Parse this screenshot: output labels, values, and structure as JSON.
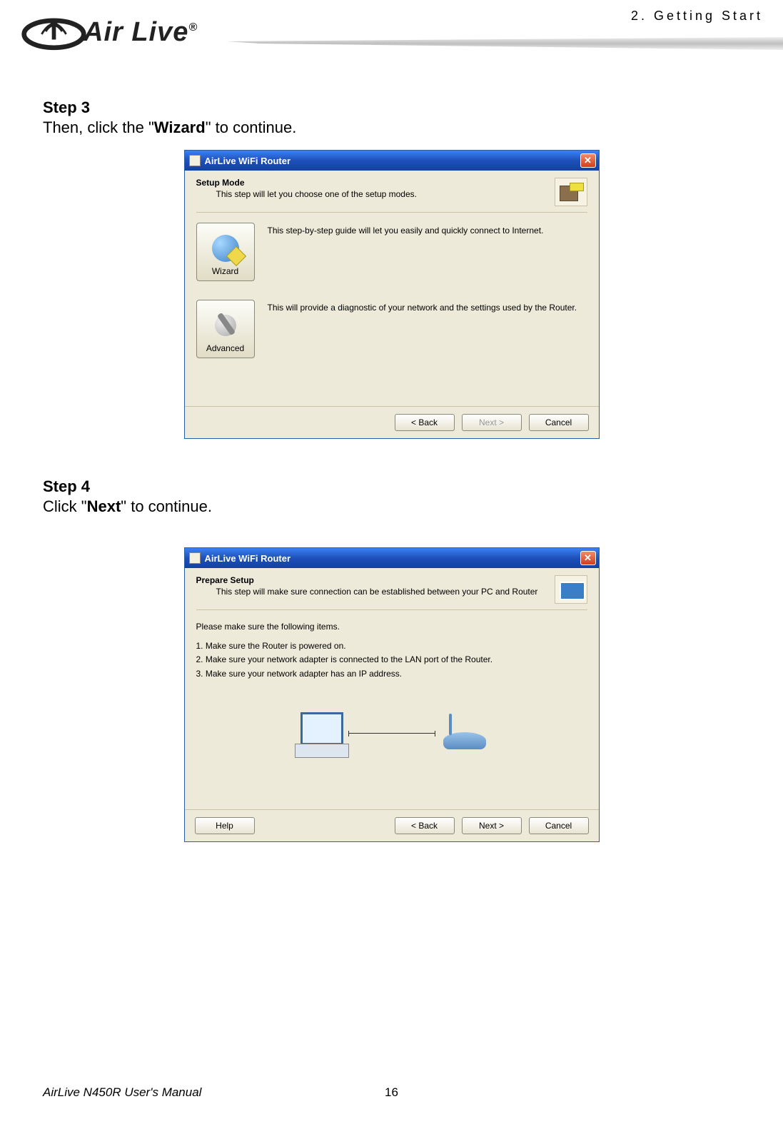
{
  "header": {
    "logo_text": "Air Live",
    "logo_tm": "®",
    "chapter": "2.  Getting  Start"
  },
  "step3": {
    "heading": "Step 3",
    "prefix": "Then, click the \"",
    "bold": "Wizard",
    "suffix": "\" to continue."
  },
  "dialog1": {
    "title": "AirLive  WiFi  Router",
    "close_label": "✕",
    "mode_title": "Setup Mode",
    "mode_sub": "This step will let you choose one of the setup modes.",
    "wizard_btn": "Wizard",
    "wizard_desc": "This step-by-step guide will let you easily and quickly connect to Internet.",
    "advanced_btn": "Advanced",
    "advanced_desc": "This will provide a diagnostic of your network and the settings used by the Router.",
    "back": "< Back",
    "next": "Next >",
    "cancel": "Cancel"
  },
  "step4": {
    "heading": "Step 4",
    "prefix": "Click \"",
    "bold": "Next",
    "suffix": "\" to continue."
  },
  "dialog2": {
    "title": "AirLive  WiFi  Router",
    "close_label": "✕",
    "mode_title": "Prepare Setup",
    "mode_sub": "This step will make sure connection can be established between your PC and Router",
    "checklist_intro": "Please make sure the following items.",
    "check1": "1. Make sure the Router is powered on.",
    "check2": "2. Make sure your network adapter is connected to the LAN port of the Router.",
    "check3": "3. Make sure your network adapter has an IP address.",
    "help": "Help",
    "back": "< Back",
    "next": "Next >",
    "cancel": "Cancel"
  },
  "footer": {
    "manual": "AirLive N450R User's Manual",
    "page": "16"
  }
}
